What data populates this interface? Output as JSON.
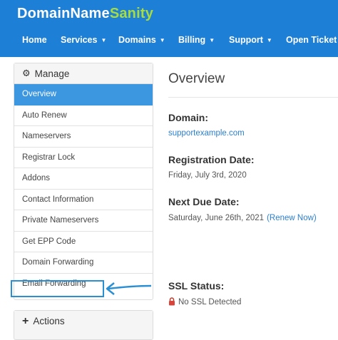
{
  "header": {
    "logo_part1": "DomainName",
    "logo_part2": "Sanity",
    "brand_color": "#1e7fd6",
    "accent_color": "#a8dc3e",
    "nav": [
      {
        "label": "Home",
        "has_caret": false
      },
      {
        "label": "Services",
        "has_caret": true
      },
      {
        "label": "Domains",
        "has_caret": true
      },
      {
        "label": "Billing",
        "has_caret": true
      },
      {
        "label": "Support",
        "has_caret": true
      },
      {
        "label": "Open Ticket",
        "has_caret": false
      }
    ]
  },
  "sidebar": {
    "title": "Manage",
    "title_icon": "gear-icon",
    "items": [
      {
        "label": "Overview",
        "active": true
      },
      {
        "label": "Auto Renew"
      },
      {
        "label": "Nameservers"
      },
      {
        "label": "Registrar Lock"
      },
      {
        "label": "Addons"
      },
      {
        "label": "Contact Information"
      },
      {
        "label": "Private Nameservers"
      },
      {
        "label": "Get EPP Code"
      },
      {
        "label": "Domain Forwarding"
      },
      {
        "label": "Email Forwarding",
        "highlighted": true
      }
    ],
    "active_color": "#3d96e0",
    "highlight_color": "#2b8fd3"
  },
  "actions": {
    "title": "Actions",
    "title_icon": "plus-icon"
  },
  "main": {
    "title": "Overview",
    "domain_label": "Domain:",
    "domain_value": "supportexample.com",
    "registration_label": "Registration Date:",
    "registration_value": "Friday, July 3rd, 2020",
    "due_label": "Next Due Date:",
    "due_value": "Saturday, June 26th, 2021",
    "renew_link": "(Renew Now)",
    "ssl_label": "SSL Status:",
    "ssl_value": "No SSL Detected",
    "ssl_icon": "lock-icon"
  }
}
